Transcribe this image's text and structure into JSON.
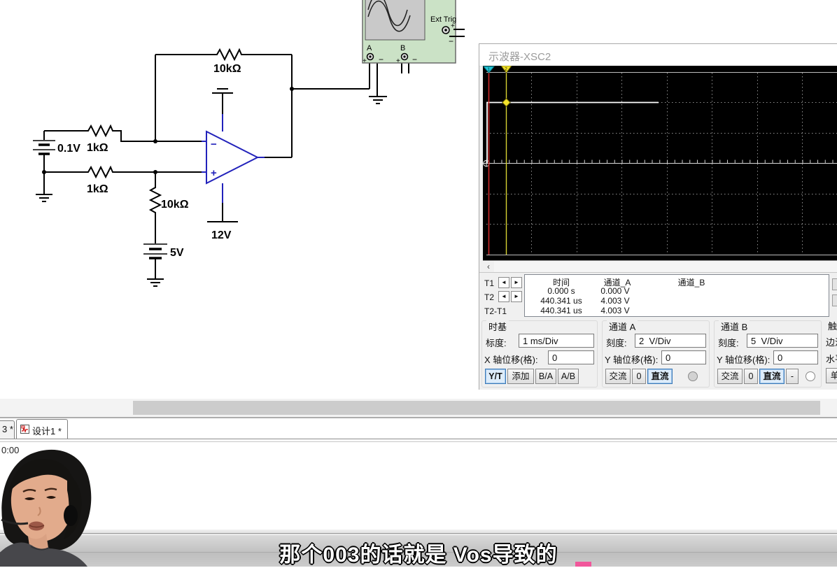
{
  "circuit": {
    "feedback_resistor_label": "10kΩ",
    "input_resistor_top_label": "1kΩ",
    "input_source_label": "0.1V",
    "input_resistor_bottom_label": "1kΩ",
    "bias_resistor_label": "10kΩ",
    "bias_source_label": "5V",
    "supply_label": "12V",
    "opamp_minus": "−",
    "opamp_plus": "+"
  },
  "scope_icon": {
    "ext_trig_label": "Ext Trig",
    "terminal_a_label": "A",
    "terminal_b_label": "B",
    "a_plus": "+",
    "a_minus": "−",
    "b_plus": "+",
    "b_minus": "−",
    "trig_plus": "+",
    "trig_minus": "−"
  },
  "scope_window": {
    "title": "示波器-XSC2",
    "cursor1": "1",
    "cursor2": "2",
    "scroll_left": "‹",
    "cursors": {
      "t1": "T1",
      "t2": "T2",
      "t2t1": "T2-T1"
    },
    "table": {
      "headers": [
        "时间",
        "通道_A",
        "通道_B"
      ],
      "rows": [
        [
          "0.000 s",
          "0.000 V",
          ""
        ],
        [
          "440.341 us",
          "4.003 V",
          ""
        ],
        [
          "440.341 us",
          "4.003 V",
          ""
        ]
      ]
    },
    "timebase": {
      "title": "时基",
      "scale_label": "标度:",
      "scale_value": "1 ms/Div",
      "offset_label": "X 轴位移(格):",
      "offset_value": "0",
      "btn_yt": "Y/T",
      "btn_add": "添加",
      "btn_ba": "B/A",
      "btn_ab": "A/B"
    },
    "channel_a": {
      "title": "通道 A",
      "scale_label": "刻度:",
      "scale_value": "2  V/Div",
      "offset_label": "Y 轴位移(格):",
      "offset_value": "0",
      "btn_ac": "交流",
      "btn_zero": "0",
      "btn_dc": "直流"
    },
    "channel_b": {
      "title": "通道 B",
      "scale_label": "刻度:",
      "scale_value": "5  V/Div",
      "offset_label": "Y 轴位移(格):",
      "offset_value": "0",
      "btn_ac": "交流",
      "btn_zero": "0",
      "btn_dc": "直流",
      "btn_minus": "-"
    },
    "trigger": {
      "title": "触发",
      "edge_label": "边沿",
      "level_label": "水平",
      "btn_single": "单"
    }
  },
  "tabs": {
    "inactive_partial": "3 *",
    "active": "设计1 *"
  },
  "statusbar": {
    "sim_time": "0:00"
  },
  "subtitle": {
    "text": "那个003的话就是 Vos导致的"
  },
  "colors": {
    "trace": "#ffffff",
    "cursor1_line": "#cc2a2a",
    "cursor2_line": "#d6d232",
    "marker1": "#23c4d6",
    "marker2": "#f3e32b",
    "scope_icon_bg": "#cbe2c6",
    "opamp": "#2222bb",
    "active_button_bg": "#ddecfa",
    "active_button_border": "#3d7ab8",
    "progress_pink": "#f1579b"
  }
}
